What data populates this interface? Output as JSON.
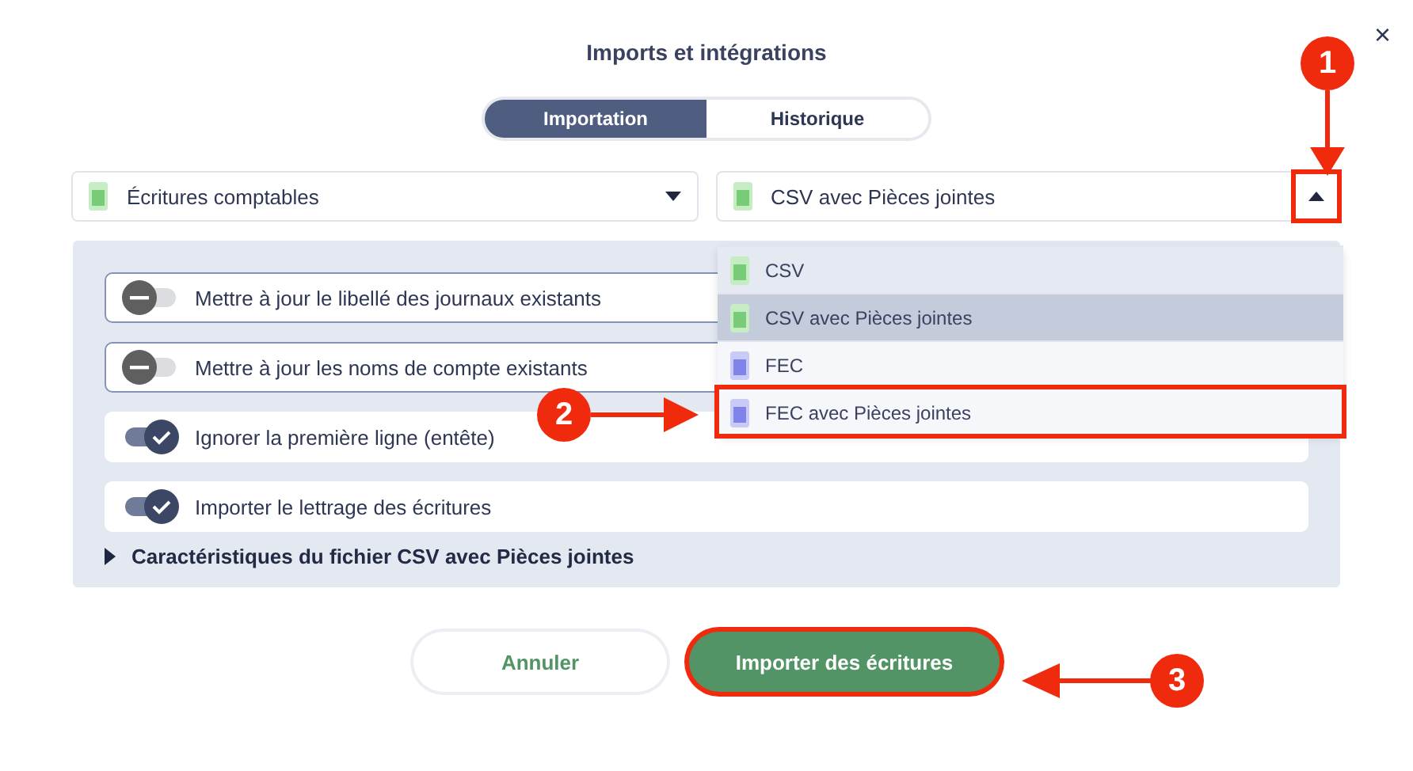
{
  "title": "Imports et intégrations",
  "close": "×",
  "tabs": [
    {
      "label": "Importation",
      "selected": true
    },
    {
      "label": "Historique",
      "selected": false
    }
  ],
  "type_select": {
    "value": "Écritures comptables"
  },
  "format_select": {
    "value": "CSV avec Pièces jointes",
    "expanded": true,
    "kind": "csv"
  },
  "format_options": [
    {
      "label": "CSV",
      "kind": "csv",
      "selected": false,
      "annotated": false
    },
    {
      "label": "CSV avec Pièces jointes",
      "kind": "csv",
      "selected": true,
      "annotated": false
    },
    {
      "label": "FEC",
      "kind": "fec",
      "selected": false,
      "annotated": false
    },
    {
      "label": "FEC avec Pièces jointes",
      "kind": "fec",
      "selected": false,
      "annotated": true
    }
  ],
  "options": [
    {
      "label": "Mettre à jour le libellé des journaux existants",
      "on": false
    },
    {
      "label": "Mettre à jour les noms de compte existants",
      "on": false
    },
    {
      "label": "Ignorer la première ligne (entête)",
      "on": true
    },
    {
      "label": "Importer le lettrage des écritures",
      "on": true
    }
  ],
  "section": {
    "label": "Caractéristiques du fichier CSV avec Pièces jointes",
    "expanded": false
  },
  "buttons": [
    {
      "label": "Annuler",
      "kind": "secondary",
      "annotated": false
    },
    {
      "label": "Importer des écritures",
      "kind": "primary",
      "annotated": true
    }
  ],
  "callouts": [
    "1",
    "2",
    "3"
  ]
}
